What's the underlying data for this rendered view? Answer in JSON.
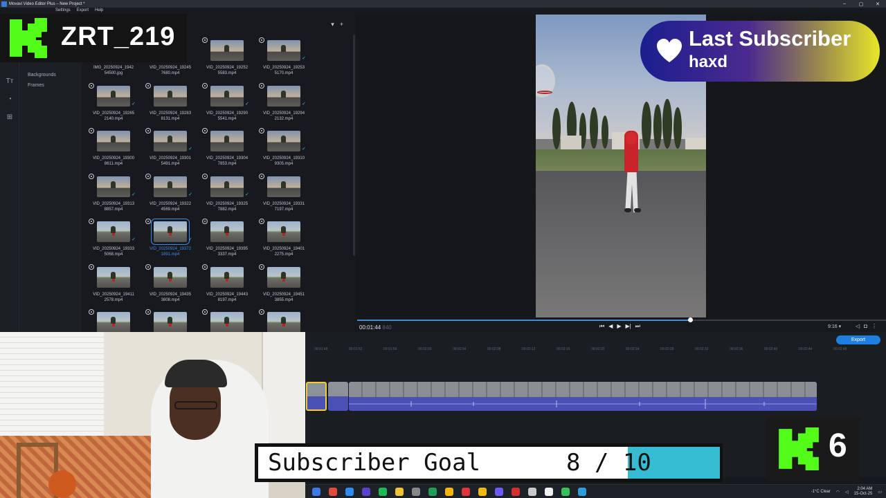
{
  "window": {
    "title": "Movavi Video Editor Plus – New Project *"
  },
  "menu": [
    "Settings",
    "Export",
    "Help"
  ],
  "nav": {
    "items": [
      "Backgrounds",
      "Frames"
    ]
  },
  "media": {
    "files": [
      {
        "name": "IMG_20250924_1942\n54500.jpg",
        "checked": false
      },
      {
        "name": "VID_20250924_19245\n7680.mp4",
        "checked": false
      },
      {
        "name": "VID_20250924_19252\n5583.mp4",
        "checked": false
      },
      {
        "name": "VID_20250924_19253\n5170.mp4",
        "checked": true
      },
      {
        "name": "VID_20250924_19265\n2140.mp4",
        "checked": true
      },
      {
        "name": "VID_20250924_19283\n8131.mp4",
        "checked": false
      },
      {
        "name": "VID_20250924_19290\n5541.mp4",
        "checked": true
      },
      {
        "name": "VID_20250924_19294\n2132.mp4",
        "checked": true
      },
      {
        "name": "VID_20250924_19300\n8611.mp4",
        "checked": false
      },
      {
        "name": "VID_20250924_19301\n5491.mp4",
        "checked": true
      },
      {
        "name": "VID_20250924_19304\n7853.mp4",
        "checked": false
      },
      {
        "name": "VID_20250924_19310\n9305.mp4",
        "checked": true
      },
      {
        "name": "VID_20250924_19313\n8857.mp4",
        "checked": true
      },
      {
        "name": "VID_20250924_19322\n4569.mp4",
        "checked": true
      },
      {
        "name": "VID_20250924_19325\n7882.mp4",
        "checked": true
      },
      {
        "name": "VID_20250924_19331\n7197.mp4",
        "checked": false
      },
      {
        "name": "VID_20250924_19333\n5068.mp4",
        "checked": true
      },
      {
        "name": "VID_20250924_19372\n1891.mp4",
        "checked": true,
        "selected": true
      },
      {
        "name": "VID_20250924_19395\n3337.mp4",
        "checked": false
      },
      {
        "name": "VID_20250924_19401\n2275.mp4",
        "checked": false
      },
      {
        "name": "VID_20250924_19411\n2578.mp4",
        "checked": false
      },
      {
        "name": "VID_20250924_19435\n3808.mp4",
        "checked": false
      },
      {
        "name": "VID_20250924_19443\n8197.mp4",
        "checked": false
      },
      {
        "name": "VID_20250924_19451\n3855.mp4",
        "checked": false
      },
      {
        "name": "",
        "checked": false
      },
      {
        "name": "",
        "checked": false
      },
      {
        "name": "",
        "checked": false
      },
      {
        "name": "",
        "checked": false
      }
    ]
  },
  "player": {
    "timecode": "00:01:44",
    "timecode_ms": "840",
    "aspect": "9:16 ▾",
    "progress": 0.63
  },
  "timeline": {
    "export_label": "Export",
    "ruler": [
      "00:01:48",
      "00:01:52",
      "00:01:56",
      "00:02:00",
      "00:02:04",
      "00:02:08",
      "00:02:12",
      "00:02:16",
      "00:02:20",
      "00:02:24",
      "00:02:28",
      "00:02:32",
      "00:02:36",
      "00:02:40",
      "00:02:44",
      "00:02:48"
    ]
  },
  "overlays": {
    "username": "ZRT_219",
    "last_subscriber_title": "Last Subscriber",
    "last_subscriber_name": "haxd",
    "goal_label": "Subscriber Goal",
    "goal_current": 8,
    "goal_target": 10,
    "goal_count_text": "8 / 10",
    "badge_count": "6",
    "brand_color": "#53fc18",
    "goal_fill_color": "#35bcd3"
  },
  "taskbar": {
    "weather": "-1°C  Clear",
    "time": "2:04 AM",
    "date": "15-Oct-25"
  }
}
